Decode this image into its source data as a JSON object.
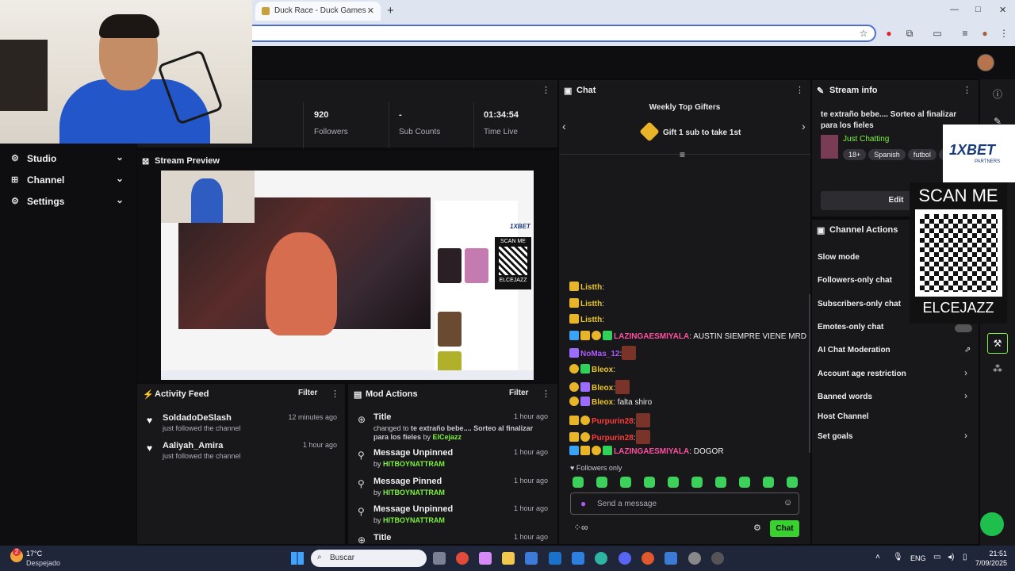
{
  "browser": {
    "tab_title": "Duck Race - Duck Games",
    "close": "✕",
    "new_tab": "+",
    "win_min": "—",
    "win_max": "□",
    "win_close": "✕"
  },
  "sidebar": {
    "items": [
      {
        "label": "Studio",
        "icon": "studio-icon"
      },
      {
        "label": "Channel",
        "icon": "channel-icon"
      },
      {
        "label": "Settings",
        "icon": "gear-icon"
      }
    ]
  },
  "stats": [
    {
      "value": "920",
      "label": "Followers"
    },
    {
      "value": "-",
      "label": "Sub Counts"
    },
    {
      "value": "01:34:54",
      "label": "Time Live"
    }
  ],
  "stats_partial_label": "s",
  "preview": {
    "title": "Stream Preview",
    "scan": "SCAN ME",
    "name": "ELCEJAZZ",
    "bet": "1XBET"
  },
  "activity": {
    "title": "Activity Feed",
    "filter": "Filter",
    "items": [
      {
        "name": "SoldadoDeSlash",
        "sub": "just followed the channel",
        "time": "12 minutes ago"
      },
      {
        "name": "Aaliyah_Amira",
        "sub": "just followed the channel",
        "time": "1 hour ago"
      }
    ]
  },
  "mod": {
    "title": "Mod Actions",
    "filter": "Filter",
    "items": [
      {
        "title": "Title",
        "pre": "changed to ",
        "bold": "te extraño bebe.... Sorteo al finalizar para los fieles",
        "by": " by ",
        "user": "ElCejazz",
        "time": "1 hour ago"
      },
      {
        "title": "Message Unpinned",
        "pre": "by ",
        "user": "HITBOYNATTRAM",
        "time": "1 hour ago"
      },
      {
        "title": "Message Pinned",
        "pre": "by ",
        "user": "HITBOYNATTRAM",
        "time": "1 hour ago"
      },
      {
        "title": "Message Unpinned",
        "pre": "by ",
        "user": "HITBOYNATTRAM",
        "time": "1 hour ago"
      },
      {
        "title": "Title",
        "time": "1 hour ago"
      }
    ]
  },
  "chat": {
    "title": "Chat",
    "gifters_title": "Weekly Top Gifters",
    "gift_text": "Gift 1 sub to take 1st",
    "messages": [
      {
        "user": "Listth",
        "sep": ":",
        "text": "",
        "color": "#e8c52a"
      },
      {
        "user": "Listth",
        "sep": ":",
        "text": "",
        "color": "#e8c52a"
      },
      {
        "user": "Listth",
        "sep": ":",
        "text": "",
        "color": "#e8c52a"
      },
      {
        "user": "LAZINGAESMIYALA",
        "sep": ":",
        "text": " AUSTIN SIEMPRE VIENE MRD",
        "color": "#ff4fa0"
      },
      {
        "user": "NoMas_12",
        "sep": ":",
        "text": "",
        "color": "#b057ff"
      },
      {
        "user": "Bleox",
        "sep": ":",
        "text": "",
        "color": "#e8c52a"
      },
      {
        "user": "Bleox",
        "sep": ":",
        "text": "",
        "color": "#e8c52a"
      },
      {
        "user": "Bleox",
        "sep": ":",
        "text": " falta shiro",
        "color": "#e8c52a"
      },
      {
        "user": "Purpurin28",
        "sep": ":",
        "text": "",
        "color": "#ff3b3b"
      },
      {
        "user": "Purpurin28",
        "sep": ":",
        "text": "",
        "color": "#ff3b3b"
      },
      {
        "user": "LAZINGAESMIYALA",
        "sep": ":",
        "text": " DOGOR",
        "color": "#ff4fa0"
      }
    ],
    "followers_only": "Followers only",
    "input_placeholder": "Send a message",
    "send": "Chat"
  },
  "stream_info": {
    "title": "Stream info",
    "stream_title": "te extraño bebe.... Sorteo al finalizar para los fieles",
    "category": "Just Chatting",
    "tags": [
      "18+",
      "Spanish",
      "futbol",
      "p"
    ],
    "edit": "Edit"
  },
  "channel_actions": {
    "title": "Channel Actions",
    "items": [
      {
        "label": "Slow mode",
        "chev": ""
      },
      {
        "label": "Followers-only chat",
        "chev": ""
      },
      {
        "label": "Subscribers-only chat",
        "chev": ""
      },
      {
        "label": "Emotes-only chat",
        "chev": ""
      },
      {
        "label": "AI Chat Moderation",
        "chev": ""
      },
      {
        "label": "Account age restriction",
        "chev": "›"
      },
      {
        "label": "Banned words",
        "chev": "›"
      },
      {
        "label": "Host Channel",
        "chev": ""
      },
      {
        "label": "Set goals",
        "chev": "›"
      }
    ]
  },
  "overlay": {
    "bet": "1XBET",
    "bet_sub": "PARTNERS",
    "scan": "SCAN ME",
    "name": "ELCEJAZZ"
  },
  "taskbar": {
    "temp": "17°C",
    "weather": "Despejado",
    "search": "Buscar",
    "lang": "ENG",
    "time": "21:51",
    "date": "7/09/2025",
    "notif": "2"
  }
}
